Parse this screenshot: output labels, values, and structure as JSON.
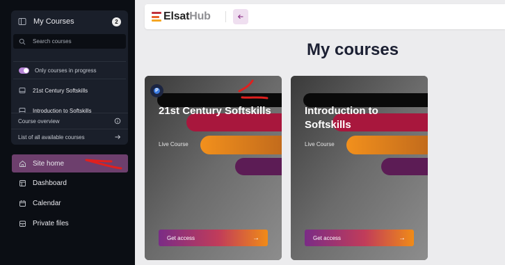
{
  "sidebar": {
    "panel": {
      "title": "My Courses",
      "count": "2",
      "search_placeholder": "Search courses",
      "toggle_label": "Only courses in progress",
      "courses": [
        "21st Century Softskills",
        "Introduction to Softskills"
      ],
      "course_overview": "Course overview",
      "all_courses": "List of all available courses"
    },
    "nav": [
      "Site home",
      "Dashboard",
      "Calendar",
      "Private files"
    ]
  },
  "header": {
    "logo_text_a": "Elsat",
    "logo_text_b": "Hub",
    "back_icon": "arrow-left-icon"
  },
  "main": {
    "title": "My courses",
    "cards": [
      {
        "title": "21st Century Softskills",
        "subtitle": "Live Course",
        "button": "Get access"
      },
      {
        "title": "Introduction to Softskills",
        "subtitle": "Live Course",
        "button": "Get access"
      }
    ]
  },
  "colors": {
    "sidebar_bg": "#0b0e14",
    "active_nav": "#6d3f6d",
    "accent_purple": "#8a2f86",
    "accent_orange": "#f08b17",
    "annotation_red": "#e0201e"
  }
}
